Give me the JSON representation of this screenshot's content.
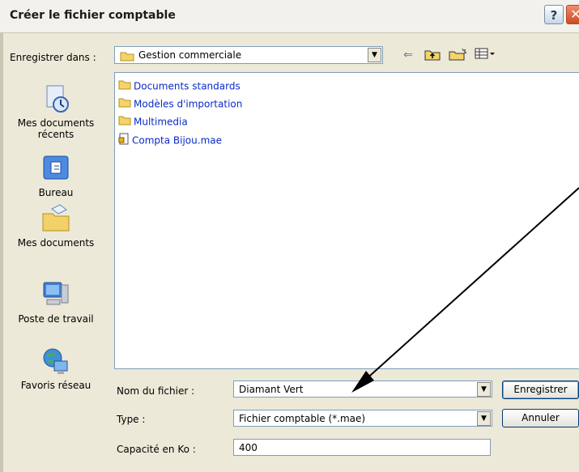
{
  "window": {
    "title": "Créer le fichier comptable",
    "help_label": "?",
    "close_label": "✕"
  },
  "toolbar": {
    "save_in_label": "Enregistrer dans :",
    "save_in_value": "Gestion commerciale",
    "back_glyph": "⇐",
    "up_glyph": "⬆",
    "new_folder_glyph": "✶",
    "views_glyph": "▦▾"
  },
  "places": [
    {
      "label": "Mes documents récents",
      "icon": "recent-documents-icon"
    },
    {
      "label": "Bureau",
      "icon": "desktop-icon"
    },
    {
      "label": "Mes documents",
      "icon": "my-documents-icon"
    },
    {
      "label": "Poste de travail",
      "icon": "my-computer-icon"
    },
    {
      "label": "Favoris réseau",
      "icon": "network-places-icon"
    }
  ],
  "files": [
    {
      "name": "Documents standards",
      "type": "folder"
    },
    {
      "name": "Modèles d'importation",
      "type": "folder"
    },
    {
      "name": "Multimedia",
      "type": "folder"
    },
    {
      "name": "Compta Bijou.mae",
      "type": "file"
    }
  ],
  "form": {
    "filename_label": "Nom du fichier :",
    "filename_value": "Diamant Vert",
    "type_label": "Type :",
    "type_value": "Fichier comptable (*.mae)",
    "capacity_label": "Capacité en Ko :",
    "capacity_value": "400"
  },
  "buttons": {
    "save": "Enregistrer",
    "cancel": "Annuler"
  },
  "colors": {
    "dialog_bg": "#ece9d8",
    "link_blue": "#0b2ac7",
    "border": "#7f9db9"
  }
}
